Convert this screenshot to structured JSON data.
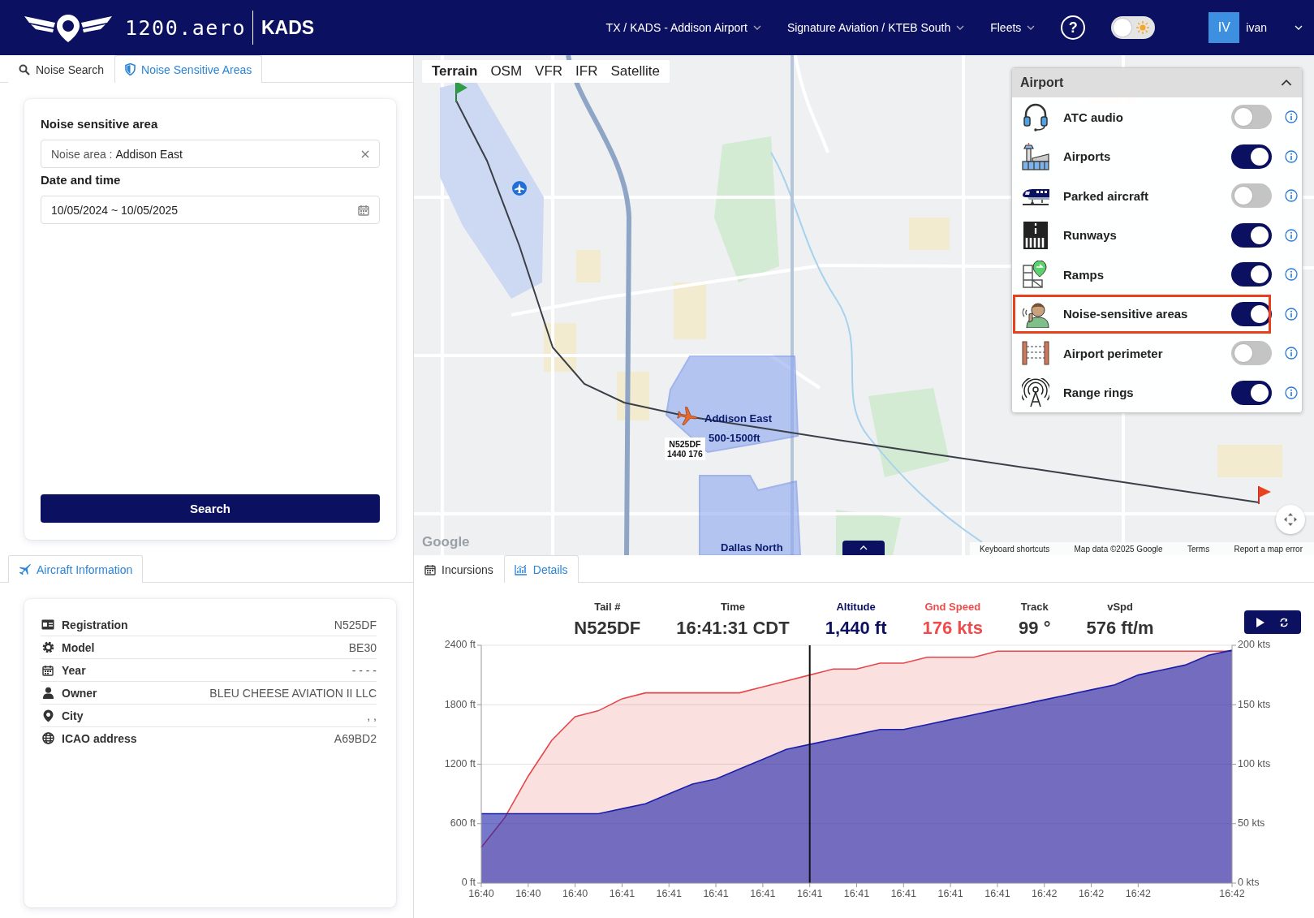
{
  "header": {
    "logo_text": "1200.aero",
    "site": "KADS",
    "menus": [
      {
        "label": "TX / KADS - Addison Airport"
      },
      {
        "label": "Signature Aviation / KTEB South"
      },
      {
        "label": "Fleets"
      }
    ],
    "help": "?",
    "theme_toggle": {
      "on": false
    },
    "user": {
      "initials": "IV",
      "name": "ivan"
    }
  },
  "search_panel": {
    "tabs": [
      {
        "label": "Noise Search",
        "selected": false
      },
      {
        "label": "Noise Sensitive Areas",
        "selected": true
      }
    ],
    "title": "Noise sensitive area",
    "area_field": {
      "label": "Noise area :",
      "value": "Addison East"
    },
    "date_label": "Date and time",
    "date_field": {
      "value": "10/05/2024 ~ 10/05/2025"
    },
    "search_button": "Search"
  },
  "map": {
    "base_layers": [
      {
        "label": "Terrain",
        "selected": true
      },
      {
        "label": "OSM",
        "selected": false
      },
      {
        "label": "VFR",
        "selected": false
      },
      {
        "label": "IFR",
        "selected": false
      },
      {
        "label": "Satellite",
        "selected": false
      }
    ],
    "layer_panel": {
      "title": "Airport",
      "expanded": true,
      "layers": [
        {
          "label": "ATC audio",
          "on": false,
          "highlighted": false
        },
        {
          "label": "Airports",
          "on": true,
          "highlighted": false
        },
        {
          "label": "Parked aircraft",
          "on": false,
          "highlighted": false
        },
        {
          "label": "Runways",
          "on": true,
          "highlighted": false
        },
        {
          "label": "Ramps",
          "on": true,
          "highlighted": false
        },
        {
          "label": "Noise-sensitive areas",
          "on": true,
          "highlighted": true
        },
        {
          "label": "Airport perimeter",
          "on": false,
          "highlighted": false
        },
        {
          "label": "Range rings",
          "on": true,
          "highlighted": false
        }
      ]
    },
    "noise_areas": [
      {
        "name": "Addison East",
        "altitudes": "500-1500ft"
      },
      {
        "name": "Dallas North"
      }
    ],
    "aircraft_label": {
      "callsign": "N525DF",
      "data": "1440 176"
    },
    "google_logo": "Google",
    "attribution": [
      "Keyboard shortcuts",
      "Map data ©2025 Google",
      "Terms",
      "Report a map error"
    ]
  },
  "aircraft_info": {
    "tabs": [
      {
        "label": "Aircraft Information",
        "selected": true
      }
    ],
    "rows": [
      {
        "label": "Registration",
        "value": "N525DF"
      },
      {
        "label": "Model",
        "value": "BE30"
      },
      {
        "label": "Year",
        "value": "- - - -"
      },
      {
        "label": "Owner",
        "value": "BLEU CHEESE AVIATION II LLC"
      },
      {
        "label": "City",
        "value": ", ,"
      },
      {
        "label": "ICAO address",
        "value": "A69BD2"
      }
    ]
  },
  "details": {
    "tabs": [
      {
        "label": "Incursions",
        "selected": false
      },
      {
        "label": "Details",
        "selected": true
      }
    ],
    "stats": [
      {
        "label": "Tail #",
        "value": "N525DF",
        "color": "#333333"
      },
      {
        "label": "Time",
        "value": "16:41:31 CDT",
        "color": "#333333"
      },
      {
        "label": "Altitude",
        "value": "1,440 ft",
        "color": "#0c1061"
      },
      {
        "label": "Gnd Speed",
        "value": "176 kts",
        "color": "#ef4b4b"
      },
      {
        "label": "Track",
        "value": "99 °",
        "color": "#333333"
      },
      {
        "label": "vSpd",
        "value": "576 ft/m",
        "color": "#333333"
      }
    ],
    "chart_data": {
      "type": "area",
      "categories": [
        "16:40",
        null,
        "16:40",
        null,
        "16:40",
        null,
        "16:41",
        null,
        "16:41",
        null,
        "16:41",
        null,
        "16:41",
        null,
        "16:41",
        null,
        "16:41",
        null,
        "16:41",
        null,
        "16:41",
        null,
        "16:41",
        null,
        "16:42",
        null,
        "16:42",
        null,
        "16:42",
        null,
        null,
        null,
        "16:42"
      ],
      "series": [
        {
          "axis": "y2",
          "color": "#e8454a",
          "values": [
            30,
            55,
            90,
            120,
            140,
            145,
            155,
            160,
            160,
            160,
            160,
            160,
            165,
            170,
            175,
            180,
            180,
            185,
            185,
            190,
            190,
            190,
            195,
            195,
            195,
            195,
            195,
            195,
            195,
            195,
            195,
            195,
            195
          ]
        },
        {
          "color": "#1a1fa8",
          "values": [
            700,
            700,
            700,
            700,
            700,
            700,
            750,
            800,
            900,
            1000,
            1050,
            1150,
            1250,
            1350,
            1400,
            1450,
            1500,
            1550,
            1550,
            1600,
            1650,
            1700,
            1750,
            1800,
            1850,
            1900,
            1950,
            2000,
            2100,
            2150,
            2200,
            2300,
            2350
          ]
        }
      ],
      "ylim": [
        0,
        2400
      ],
      "y2lim": [
        0,
        200
      ],
      "yticks": [
        {
          "value": 0,
          "label": "0 ft"
        },
        {
          "value": 600,
          "label": "600 ft"
        },
        {
          "value": 1200,
          "label": "1200 ft"
        },
        {
          "value": 1800,
          "label": "1800 ft"
        },
        {
          "value": 2400,
          "label": "2400 ft"
        }
      ],
      "y2ticks": [
        {
          "value": 0,
          "label": "0 kts"
        },
        {
          "value": 50,
          "label": "50 kts"
        },
        {
          "value": 100,
          "label": "100 kts"
        },
        {
          "value": 150,
          "label": "150 kts"
        },
        {
          "value": 200,
          "label": "200 kts"
        }
      ],
      "grid": true,
      "annotations": [
        {
          "x": "16:41"
        }
      ]
    }
  }
}
